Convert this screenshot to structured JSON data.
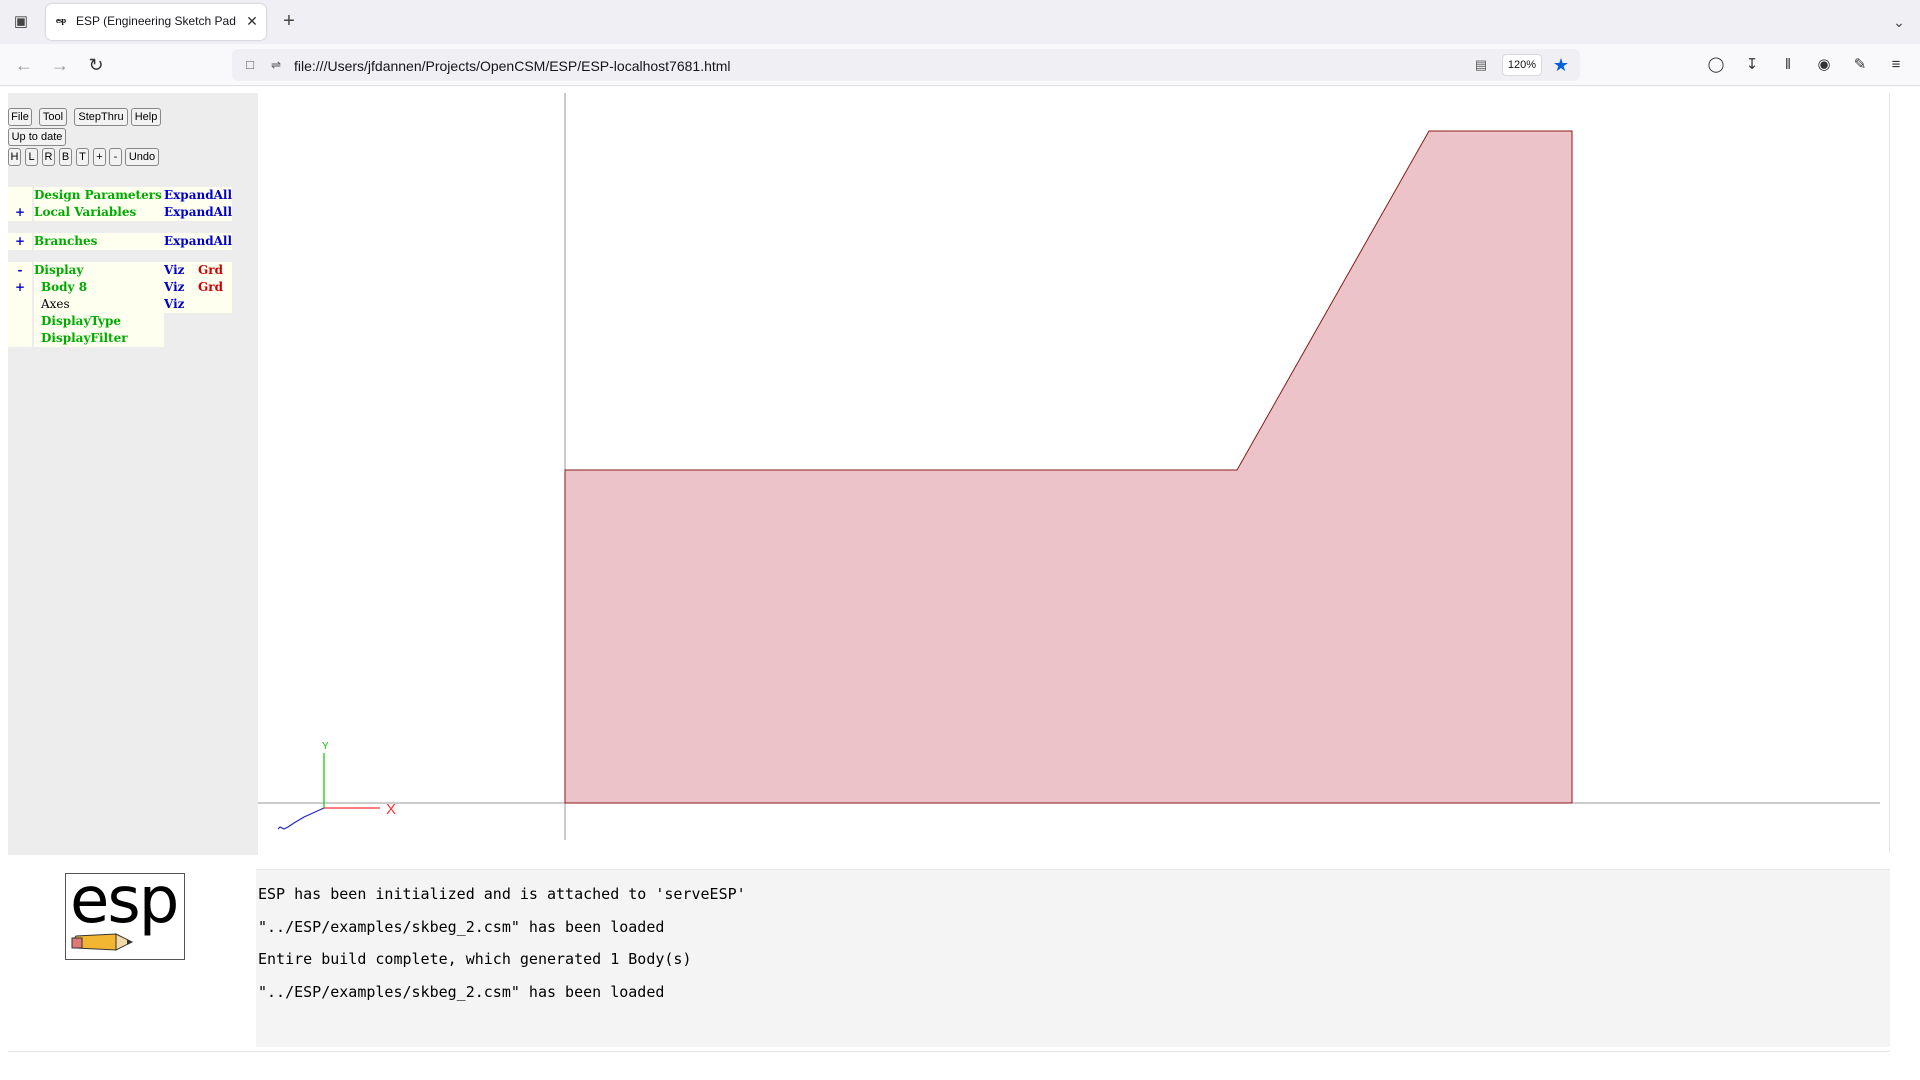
{
  "browser": {
    "tab_title": "ESP (Engineering Sketch Pad, V",
    "tab_favicon_text": "esp",
    "url": "file:///Users/jfdannen/Projects/OpenCSM/ESP/ESP-localhost7681.html",
    "zoom": "120%",
    "icons": {
      "tab_list": "tab-list-icon",
      "close": "close-icon",
      "new_tab": "plus-icon",
      "overflow": "chevron-down-icon",
      "back": "back-arrow-icon",
      "forward": "forward-arrow-icon",
      "reload": "reload-icon",
      "page": "page-icon",
      "permissions": "permissions-icon",
      "reader": "reader-view-icon",
      "bookmark": "star-icon",
      "pocket": "pocket-icon",
      "downloads": "download-icon",
      "library": "library-icon",
      "account": "account-icon",
      "extensions": "extensions-icon",
      "menu": "hamburger-menu-icon"
    },
    "bookmark_color": "#0061e0"
  },
  "toolbar": {
    "file": "File",
    "tool": "Tool",
    "stepthru": "StepThru",
    "help": "Help",
    "status": "Up to date",
    "view_h": "H",
    "view_l": "L",
    "view_r": "R",
    "view_b": "B",
    "view_t": "T",
    "zoom_in": "+",
    "zoom_out": "-",
    "undo": "Undo"
  },
  "tree": {
    "design_parameters": {
      "name": "Design Parameters",
      "action": "ExpandAll"
    },
    "local_variables": {
      "sign": "+",
      "name": "Local Variables",
      "action": "ExpandAll"
    },
    "branches": {
      "sign": "+",
      "name": "Branches",
      "action": "ExpandAll"
    },
    "display": {
      "sign": "-",
      "name": "Display",
      "viz": "Viz",
      "grd": "Grd"
    },
    "body": {
      "sign": "+",
      "name": "Body 8",
      "viz": "Viz",
      "grd": "Grd"
    },
    "axes": {
      "name": "Axes",
      "viz": "Viz"
    },
    "display_type": {
      "name": "DisplayType"
    },
    "display_filter": {
      "name": "DisplayFilter"
    }
  },
  "colors": {
    "tree_green": "#00aa00",
    "tree_blue": "#0000cc",
    "tree_red": "#cc0000",
    "shape_fill": "#ecc3c8",
    "shape_edge": "#8b1a1a"
  },
  "axes_triad": {
    "x_label": "X",
    "y_label": "Y"
  },
  "logo": {
    "text": "esp"
  },
  "messages": [
    "ESP has been initialized and is attached to 'serveESP'",
    "\"../ESP/examples/skbeg_2.csm\" has been loaded",
    "Entire build complete, which generated 1 Body(s)",
    "\"../ESP/examples/skbeg_2.csm\" has been loaded"
  ]
}
